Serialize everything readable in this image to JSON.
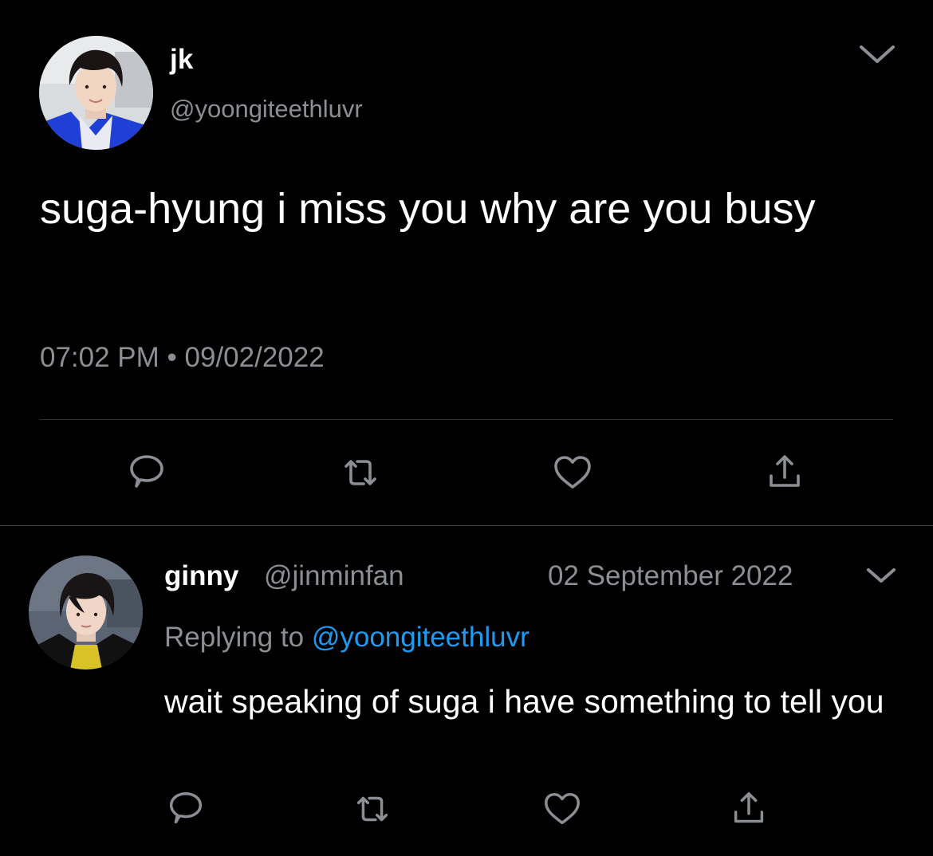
{
  "main_tweet": {
    "display_name": "jk",
    "handle": "@yoongiteethluvr",
    "text": "suga-hyung i miss you why are you busy",
    "timestamp": "07:02 PM • 09/02/2022",
    "avatar_icon": "profile-photo",
    "menu_icon": "chevron-down-icon"
  },
  "reply_tweet": {
    "display_name": "ginny",
    "handle": "@jinminfan",
    "date": "02 September 2022",
    "replying_prefix": "Replying to ",
    "replying_mention": "@yoongiteethluvr",
    "text": "wait speaking of suga i have something to tell you",
    "avatar_icon": "profile-photo",
    "menu_icon": "chevron-down-icon"
  },
  "actions": [
    "reply-icon",
    "retweet-icon",
    "like-icon",
    "share-icon"
  ],
  "colors": {
    "background": "#000000",
    "primary_text": "#ffffff",
    "secondary_text": "#8b8f94",
    "link": "#1d9bf0",
    "divider": "#35383c"
  }
}
